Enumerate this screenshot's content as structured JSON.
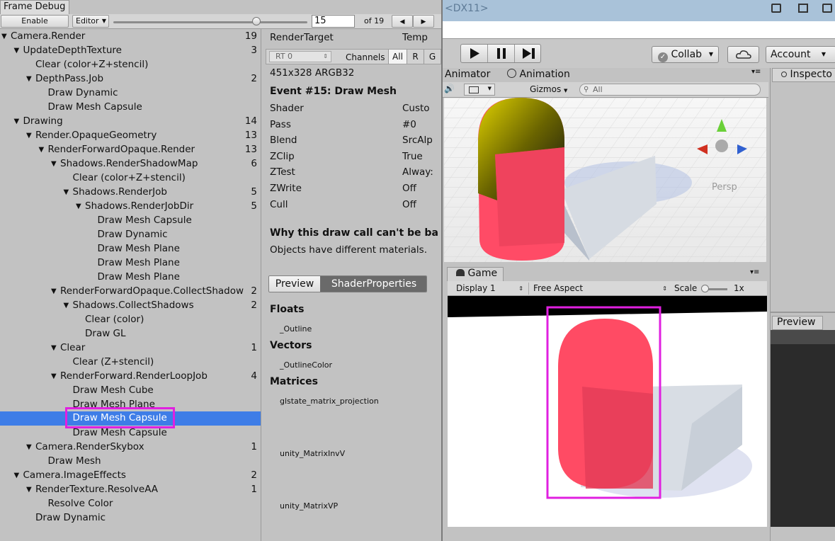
{
  "frame_debug": {
    "window_title": "Frame Debug",
    "enable_label": "Enable",
    "editor_label": "Editor",
    "event_index": "15",
    "event_total": "of 19",
    "slider_fraction": 0.737,
    "prev_icon": "previous-arrow",
    "next_icon": "next-arrow",
    "tree": [
      {
        "label": "Camera.Render",
        "count": "19",
        "depth": 0,
        "expanded": true
      },
      {
        "label": "UpdateDepthTexture",
        "count": "3",
        "depth": 1,
        "expanded": true
      },
      {
        "label": "Clear (color+Z+stencil)",
        "count": "",
        "depth": 2,
        "expanded": null
      },
      {
        "label": "DepthPass.Job",
        "count": "2",
        "depth": 2,
        "expanded": true
      },
      {
        "label": "Draw Dynamic",
        "count": "",
        "depth": 3,
        "expanded": null
      },
      {
        "label": "Draw Mesh Capsule",
        "count": "",
        "depth": 3,
        "expanded": null
      },
      {
        "label": "Drawing",
        "count": "14",
        "depth": 1,
        "expanded": true
      },
      {
        "label": "Render.OpaqueGeometry",
        "count": "13",
        "depth": 2,
        "expanded": true
      },
      {
        "label": "RenderForwardOpaque.Render",
        "count": "13",
        "depth": 3,
        "expanded": true
      },
      {
        "label": "Shadows.RenderShadowMap",
        "count": "6",
        "depth": 4,
        "expanded": true
      },
      {
        "label": "Clear (color+Z+stencil)",
        "count": "",
        "depth": 5,
        "expanded": null
      },
      {
        "label": "Shadows.RenderJob",
        "count": "5",
        "depth": 5,
        "expanded": true
      },
      {
        "label": "Shadows.RenderJobDir",
        "count": "5",
        "depth": 6,
        "expanded": true
      },
      {
        "label": "Draw Mesh Capsule",
        "count": "",
        "depth": 7,
        "expanded": null
      },
      {
        "label": "Draw Dynamic",
        "count": "",
        "depth": 7,
        "expanded": null
      },
      {
        "label": "Draw Mesh Plane",
        "count": "",
        "depth": 7,
        "expanded": null
      },
      {
        "label": "Draw Mesh Plane",
        "count": "",
        "depth": 7,
        "expanded": null
      },
      {
        "label": "Draw Mesh Plane",
        "count": "",
        "depth": 7,
        "expanded": null
      },
      {
        "label": "RenderForwardOpaque.CollectShadow",
        "count": "2",
        "depth": 4,
        "expanded": true
      },
      {
        "label": "Shadows.CollectShadows",
        "count": "2",
        "depth": 5,
        "expanded": true
      },
      {
        "label": "Clear (color)",
        "count": "",
        "depth": 6,
        "expanded": null
      },
      {
        "label": "Draw GL",
        "count": "",
        "depth": 6,
        "expanded": null
      },
      {
        "label": "Clear",
        "count": "1",
        "depth": 4,
        "expanded": true
      },
      {
        "label": "Clear (Z+stencil)",
        "count": "",
        "depth": 5,
        "expanded": null
      },
      {
        "label": "RenderForward.RenderLoopJob",
        "count": "4",
        "depth": 4,
        "expanded": true
      },
      {
        "label": "Draw Mesh Cube",
        "count": "",
        "depth": 5,
        "expanded": null
      },
      {
        "label": "Draw Mesh Plane",
        "count": "",
        "depth": 5,
        "expanded": null
      },
      {
        "label": "Draw Mesh Capsule",
        "count": "",
        "depth": 5,
        "expanded": null,
        "selected": true
      },
      {
        "label": "Draw Mesh Capsule",
        "count": "",
        "depth": 5,
        "expanded": null
      },
      {
        "label": "Camera.RenderSkybox",
        "count": "1",
        "depth": 2,
        "expanded": true
      },
      {
        "label": "Draw Mesh",
        "count": "",
        "depth": 3,
        "expanded": null
      },
      {
        "label": "Camera.ImageEffects",
        "count": "2",
        "depth": 1,
        "expanded": true
      },
      {
        "label": "RenderTexture.ResolveAA",
        "count": "1",
        "depth": 2,
        "expanded": true
      },
      {
        "label": "Resolve Color",
        "count": "",
        "depth": 3,
        "expanded": null
      },
      {
        "label": "Draw Dynamic",
        "count": "",
        "depth": 2,
        "expanded": null
      }
    ],
    "details": {
      "render_target_label": "RenderTarget",
      "render_target_value": "Temp",
      "rt_select": "RT 0",
      "channels_label": "Channels",
      "channel_all": "All",
      "channel_r": "R",
      "channel_g": "G",
      "resolution": "451x328 ARGB32",
      "event_title": "Event #15: Draw Mesh",
      "props": [
        {
          "key": "Shader",
          "value": "Custo"
        },
        {
          "key": "Pass",
          "value": "#0"
        },
        {
          "key": "Blend",
          "value": "SrcAlp"
        },
        {
          "key": "ZClip",
          "value": "True"
        },
        {
          "key": "ZTest",
          "value": "Alway:"
        },
        {
          "key": "ZWrite",
          "value": "Off"
        },
        {
          "key": "Cull",
          "value": "Off"
        }
      ],
      "batch_title": "Why this draw call can't be ba",
      "batch_reason": "Objects have different materials.",
      "tab_preview": "Preview",
      "tab_shader_props": "ShaderProperties",
      "floats_heading": "Floats",
      "float_item": "_Outline",
      "vectors_heading": "Vectors",
      "vector_item": "_OutlineColor",
      "matrices_heading": "Matrices",
      "matrix_1": "glstate_matrix_projection",
      "matrix_2": "unity_MatrixInvV",
      "matrix_3": "unity_MatrixVP"
    }
  },
  "editor": {
    "top_title": "<DX11>",
    "play_icon": "play-icon",
    "pause_icon": "pause-icon",
    "step_icon": "step-icon",
    "collab_label": "Collab",
    "cloud_icon": "cloud-icon",
    "account_label": "Account",
    "animator_tab": "Animator",
    "animation_tab": "Animation",
    "gizmos_label": "Gizmos",
    "search_placeholder": "All",
    "persp_label": "Persp",
    "game_tab": "Game",
    "display_label": "Display 1",
    "aspect_label": "Free Aspect",
    "scale_label": "Scale",
    "scale_value": "1x",
    "inspector_tab": "Inspecto",
    "preview_tab": "Preview"
  },
  "colors": {
    "selection": "#3e7de7",
    "highlight_box": "#e020e0",
    "capsule_red": "#ff3f5f",
    "capsule_yellow": "#d4c400"
  }
}
